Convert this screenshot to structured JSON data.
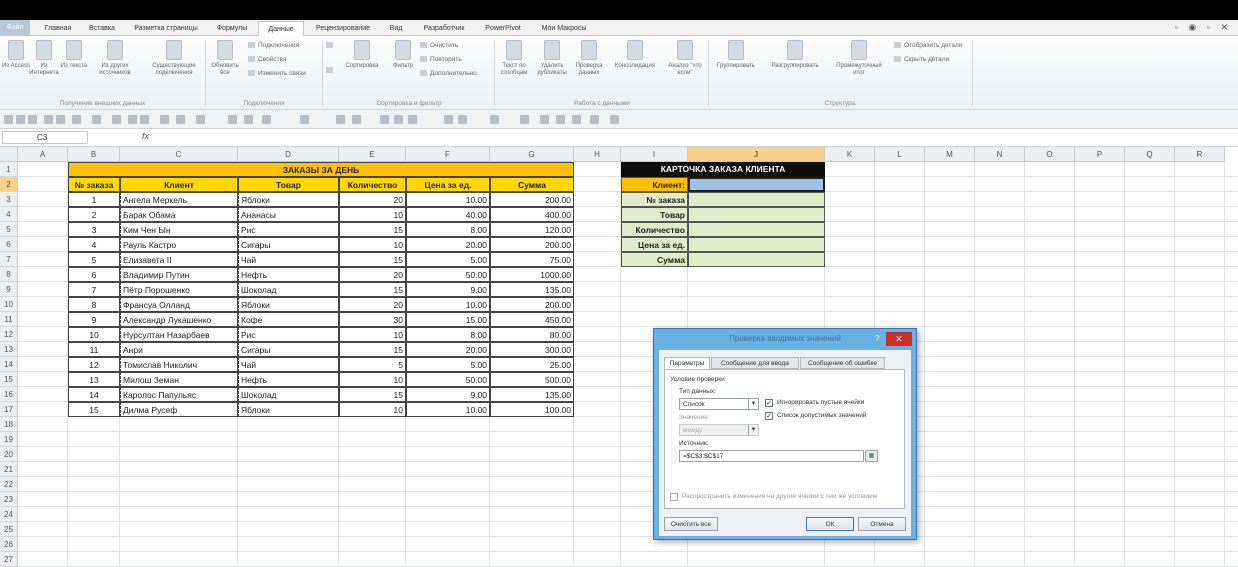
{
  "ribbon": {
    "tabs": [
      "Файл",
      "Главная",
      "Вставка",
      "Разметка страницы",
      "Формулы",
      "Данные",
      "Рецензирование",
      "Вид",
      "Разработчик",
      "PowerPivot",
      "Мои Макросы"
    ],
    "active_tab": "Данные",
    "buttons": {
      "from_access": "Из Access",
      "from_web": "Из Интернета",
      "from_text": "Из текста",
      "from_other": "Из других источников",
      "existing": "Существующие подключения",
      "refresh": "Обновить все",
      "connections": "Подключения",
      "properties": "Свойства",
      "edit_links": "Изменить связи",
      "sort": "Сортировка",
      "filter": "Фильтр",
      "clear": "Очистить",
      "reapply": "Повторить",
      "advanced": "Дополнительно",
      "text_to_columns": "Текст по столбцам",
      "remove_duplicates": "Удалить дубликаты",
      "data_validation": "Проверка данных",
      "consolidate": "Консолидация",
      "what_if": "Анализ \"что если\"",
      "group": "Группировать",
      "ungroup": "Разгруппировать",
      "subtotal": "Промежуточный итог",
      "show_detail": "Отобразить детали",
      "hide_detail": "Скрыть детали"
    },
    "groups": {
      "external": "Получение внешних данных",
      "connections": "Подключения",
      "sort_filter": "Сортировка и фильтр",
      "data_tools": "Работа с данными",
      "outline": "Структура"
    }
  },
  "formula_bar": {
    "name_box": "C3",
    "fx": "fx",
    "value": ""
  },
  "columns": [
    "A",
    "B",
    "C",
    "D",
    "E",
    "F",
    "G",
    "H",
    "I",
    "J",
    "K",
    "L",
    "M",
    "N",
    "O",
    "P",
    "Q",
    "R"
  ],
  "rows": [
    "1",
    "2",
    "3",
    "4",
    "5",
    "6",
    "7",
    "8",
    "9",
    "10",
    "11",
    "12",
    "13",
    "14",
    "15",
    "16",
    "17",
    "18",
    "19",
    "20",
    "21",
    "22",
    "23",
    "24",
    "25",
    "26",
    "27"
  ],
  "orders": {
    "title": "ЗАКАЗЫ ЗА ДЕНЬ",
    "headers": [
      "№ заказа",
      "Клиент",
      "Товар",
      "Количество",
      "Цена за ед.",
      "Сумма"
    ],
    "rows": [
      [
        "1",
        "Ангела Меркель",
        "Яблоки",
        "20",
        "10.00",
        "200.00"
      ],
      [
        "2",
        "Барак Обама",
        "Ананасы",
        "10",
        "40.00",
        "400.00"
      ],
      [
        "3",
        "Ким Чен Ын",
        "Рис",
        "15",
        "8.00",
        "120.00"
      ],
      [
        "4",
        "Рауль Кастро",
        "Сигары",
        "10",
        "20.00",
        "200.00"
      ],
      [
        "5",
        "Елизавета II",
        "Чай",
        "15",
        "5.00",
        "75.00"
      ],
      [
        "6",
        "Владимир Путин",
        "Нефть",
        "20",
        "50.00",
        "1000.00"
      ],
      [
        "7",
        "Пётр Порошенко",
        "Шоколад",
        "15",
        "9.00",
        "135.00"
      ],
      [
        "8",
        "Франсуа Олланд",
        "Яблоки",
        "20",
        "10.00",
        "200.00"
      ],
      [
        "9",
        "Александр Лукашенко",
        "Кофе",
        "30",
        "15.00",
        "450.00"
      ],
      [
        "10",
        "Нурсултан Назарбаев",
        "Рис",
        "10",
        "8.00",
        "80.00"
      ],
      [
        "11",
        "Анри",
        "Сигары",
        "15",
        "20.00",
        "300.00"
      ],
      [
        "12",
        "Томислав Николич",
        "Чай",
        "5",
        "5.00",
        "25.00"
      ],
      [
        "13",
        "Милош Земан",
        "Нефть",
        "10",
        "50.00",
        "500.00"
      ],
      [
        "14",
        "Каролос Папульяс",
        "Шоколад",
        "15",
        "9.00",
        "135.00"
      ],
      [
        "15",
        "Дилма Русеф",
        "Яблоки",
        "10",
        "10.00",
        "100.00"
      ]
    ]
  },
  "card": {
    "title": "КАРТОЧКА ЗАКАЗА КЛИЕНТА",
    "labels": [
      "Клиент:",
      "№ заказа",
      "Товар",
      "Количество",
      "Цена за ед.",
      "Сумма"
    ]
  },
  "dialog": {
    "title": "Проверка вводимых значений",
    "help": "?",
    "close": "✕",
    "tabs": [
      "Параметры",
      "Сообщение для ввода",
      "Сообщение об ошибке"
    ],
    "section": "Условие проверки",
    "type_label": "Тип данных:",
    "type_value": "Список",
    "ignore_blank": "Игнорировать пустые ячейки",
    "dropdown": "Список допустимых значений",
    "value_label": "Значение:",
    "value_value": "между",
    "source_label": "Источник:",
    "source_value": "=$C$3:$C$17",
    "apply_all": "Распространить изменения на другие ячейки с тем же условием",
    "clear_all": "Очистить все",
    "ok": "ОК",
    "cancel": "Отмена"
  },
  "colors": {
    "header_yellow": "#ffd800",
    "title_yellow": "#ffc000",
    "card_green": "#e3ebc9",
    "dialog_frame": "#6bb0e4"
  }
}
